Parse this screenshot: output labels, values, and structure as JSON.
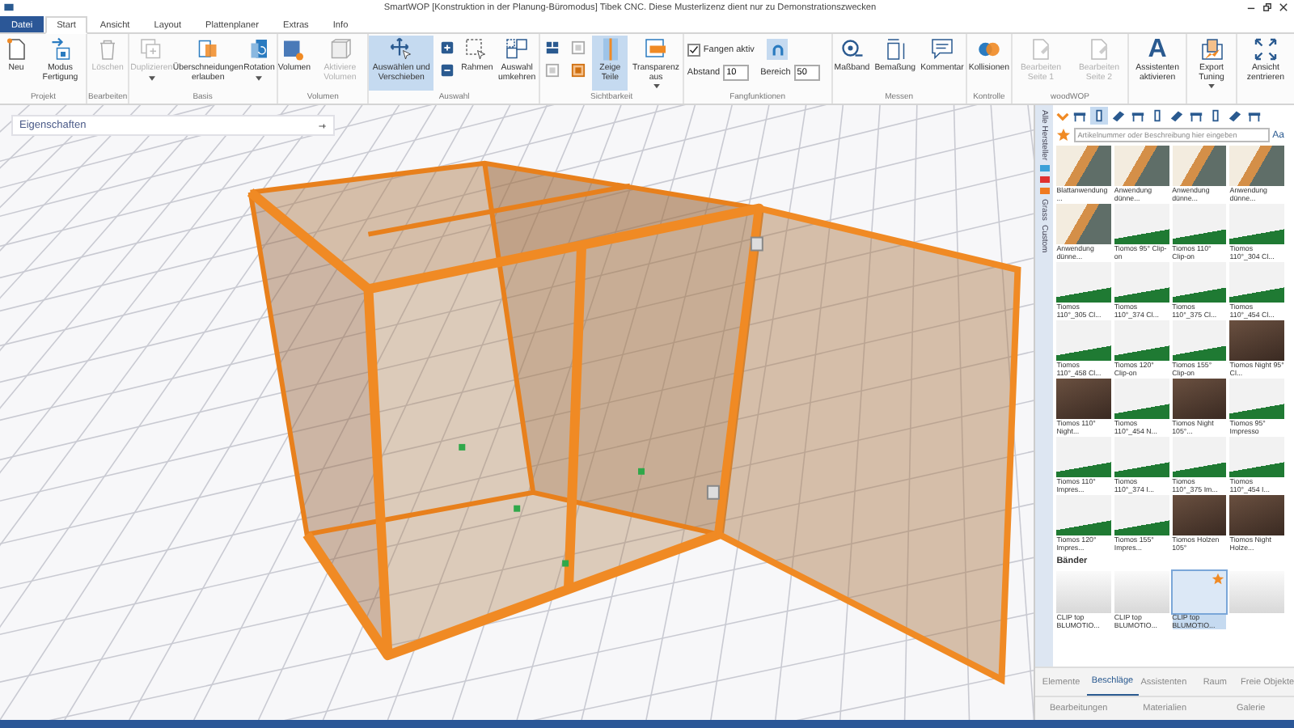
{
  "window": {
    "title": "SmartWOP [Konstruktion in der Planung-Büromodus] Tibek CNC. Diese Musterlizenz dient nur zu Demonstrationszwecken"
  },
  "menu_tabs": [
    {
      "label": "Datei",
      "kind": "file",
      "selected": false
    },
    {
      "label": "Start",
      "kind": "tab",
      "selected": true
    },
    {
      "label": "Ansicht",
      "kind": "tab",
      "selected": false
    },
    {
      "label": "Layout",
      "kind": "tab",
      "selected": false
    },
    {
      "label": "Plattenplaner",
      "kind": "tab",
      "selected": false
    },
    {
      "label": "Extras",
      "kind": "tab",
      "selected": false
    },
    {
      "label": "Info",
      "kind": "tab",
      "selected": false
    }
  ],
  "ribbon": {
    "groups": [
      {
        "label": "Projekt",
        "items": [
          {
            "kind": "large",
            "label": "Neu",
            "disabled": false,
            "selected": false
          },
          {
            "kind": "large",
            "label": "Modus Fertigung",
            "disabled": false,
            "selected": false
          }
        ]
      },
      {
        "label": "Bearbeiten",
        "items": [
          {
            "kind": "large",
            "label": "Löschen",
            "disabled": true,
            "selected": false
          }
        ]
      },
      {
        "label": "Basis",
        "items": [
          {
            "kind": "large",
            "label": "Duplizieren",
            "disabled": true,
            "selected": false,
            "dropdown": true
          },
          {
            "kind": "large",
            "label": "Überschneidungen erlauben",
            "disabled": false,
            "selected": false
          },
          {
            "kind": "large",
            "label": "Rotation",
            "disabled": false,
            "selected": false,
            "dropdown": true
          }
        ]
      },
      {
        "label": "Volumen",
        "items": [
          {
            "kind": "large",
            "label": "Volumen",
            "disabled": false,
            "selected": false
          },
          {
            "kind": "large",
            "label": "Aktiviere Volumen",
            "disabled": true,
            "selected": false
          }
        ]
      },
      {
        "label": "Auswahl",
        "items": [
          {
            "kind": "large",
            "label": "Auswählen und Verschieben",
            "disabled": false,
            "selected": true
          },
          {
            "kind": "small_stack"
          },
          {
            "kind": "large",
            "label": "Rahmen",
            "disabled": false,
            "selected": false
          },
          {
            "kind": "large",
            "label": "Auswahl umkehren",
            "disabled": false,
            "selected": false
          }
        ]
      },
      {
        "label": "Sichtbarkeit",
        "items": [
          {
            "kind": "small_stack"
          },
          {
            "kind": "small_stack"
          },
          {
            "kind": "large",
            "label": "Zeige Teile",
            "disabled": false,
            "selected": true
          },
          {
            "kind": "large",
            "label": "Transparenz aus",
            "disabled": false,
            "selected": false,
            "dropdown": true
          }
        ]
      },
      {
        "label": "Fangfunktionen",
        "items": [
          {
            "kind": "snap",
            "check_label": "Fangen aktiv",
            "checked": true,
            "magnet_selected": true,
            "fields": [
              {
                "label": "Abstand",
                "value": "10"
              },
              {
                "label": "Bereich",
                "value": "50"
              }
            ]
          }
        ]
      },
      {
        "label": "Messen",
        "items": [
          {
            "kind": "large",
            "label": "Maßband",
            "disabled": false,
            "selected": false
          },
          {
            "kind": "large",
            "label": "Bemaßung",
            "disabled": false,
            "selected": false
          },
          {
            "kind": "large",
            "label": "Kommentar",
            "disabled": false,
            "selected": false
          }
        ]
      },
      {
        "label": "Kontrolle",
        "items": [
          {
            "kind": "large",
            "label": "Kollisionen",
            "disabled": false,
            "selected": false
          }
        ]
      },
      {
        "label": "woodWOP",
        "items": [
          {
            "kind": "large",
            "label": "Bearbeiten Seite 1",
            "disabled": true,
            "selected": false
          },
          {
            "kind": "large",
            "label": "Bearbeiten Seite 2",
            "disabled": true,
            "selected": false
          }
        ]
      },
      {
        "items": [
          {
            "kind": "large",
            "label": "Assistenten aktivieren",
            "glyph": "A",
            "disabled": false,
            "selected": false
          }
        ]
      },
      {
        "items": [
          {
            "kind": "large",
            "label": "Export Tuning",
            "disabled": false,
            "selected": false,
            "dropdown": true
          }
        ]
      },
      {
        "items": [
          {
            "kind": "large",
            "label": "Ansicht zentrieren",
            "disabled": false,
            "selected": false
          }
        ]
      }
    ]
  },
  "properties_panel": {
    "title": "Eigenschaften"
  },
  "library": {
    "side_tabs": [
      {
        "label": "Alle Hersteller",
        "kind": "text"
      },
      {
        "kind": "logo",
        "color": "#3aa0d8"
      },
      {
        "kind": "logo",
        "color": "#e03030"
      },
      {
        "kind": "logo",
        "color": "#f07a20"
      },
      {
        "label": "Grass",
        "kind": "text"
      },
      {
        "label": "Custom",
        "kind": "text"
      }
    ],
    "category_icons": [
      {
        "selected": false
      },
      {
        "selected": true
      },
      {
        "selected": false
      },
      {
        "selected": false
      },
      {
        "selected": false
      },
      {
        "selected": false
      },
      {
        "selected": false
      },
      {
        "selected": false
      },
      {
        "selected": false
      },
      {
        "selected": false
      }
    ],
    "search": {
      "placeholder": "Artikelnummer oder Beschreibung hier eingeben"
    },
    "case_toggle": "Aa",
    "items": [
      {
        "caption": "Blattanwendung ...",
        "kind": "wall"
      },
      {
        "caption": "Anwendung dünne...",
        "kind": "wall"
      },
      {
        "caption": "Anwendung dünne...",
        "kind": "wall"
      },
      {
        "caption": "Anwendung dünne...",
        "kind": "wall"
      },
      {
        "caption": "Anwendung dünne...",
        "kind": "wall"
      },
      {
        "caption": "Tiomos 95° Clip-on",
        "kind": "hinge"
      },
      {
        "caption": "Tiomos 110° Clip-on",
        "kind": "hinge"
      },
      {
        "caption": "Tiomos 110°_304 Cl...",
        "kind": "hinge"
      },
      {
        "caption": "Tiomos 110°_305 Cl...",
        "kind": "hinge"
      },
      {
        "caption": "Tiomos 110°_374 Cl...",
        "kind": "hinge"
      },
      {
        "caption": "Tiomos 110°_375 Cl...",
        "kind": "hinge"
      },
      {
        "caption": "Tiomos 110°_454 Cl...",
        "kind": "hinge"
      },
      {
        "caption": "Tiomos 110°_458 Cl...",
        "kind": "hinge"
      },
      {
        "caption": "Tiomos 120° Clip-on",
        "kind": "hinge"
      },
      {
        "caption": "Tiomos 155° Clip-on",
        "kind": "hinge"
      },
      {
        "caption": "Tiomos Night 95° Cl...",
        "kind": "wood"
      },
      {
        "caption": "Tiomos 110° Night...",
        "kind": "wood"
      },
      {
        "caption": "Tiomos 110°_454 N...",
        "kind": "hinge"
      },
      {
        "caption": "Tiomos Night 105°...",
        "kind": "wood"
      },
      {
        "caption": "Tiomos 95° Impresso",
        "kind": "hinge"
      },
      {
        "caption": "Tiomos 110° Impres...",
        "kind": "hinge"
      },
      {
        "caption": "Tiomos 110°_374 I...",
        "kind": "hinge"
      },
      {
        "caption": "Tiomos 110°_375 Im...",
        "kind": "hinge"
      },
      {
        "caption": "Tiomos 110°_454 I...",
        "kind": "hinge"
      },
      {
        "caption": "Tiomos 120° Impres...",
        "kind": "hinge"
      },
      {
        "caption": "Tiomos 155° Impres...",
        "kind": "hinge"
      },
      {
        "caption": "Tiomos Holzen 105°",
        "kind": "wood"
      },
      {
        "caption": "Tiomos Night Holze...",
        "kind": "wood"
      }
    ],
    "section_title": "Bänder",
    "section_items": [
      {
        "caption": "CLIP top BLUMOTIO...",
        "selected": false,
        "favorite": false
      },
      {
        "caption": "CLIP top BLUMOTIO...",
        "selected": false,
        "favorite": false
      },
      {
        "caption": "CLIP top BLUMOTIO...",
        "selected": true,
        "favorite": true
      },
      {
        "selected": false,
        "favorite": false
      }
    ],
    "bottom_tabs": [
      {
        "label": "Elemente",
        "selected": false
      },
      {
        "label": "Beschläge",
        "selected": true
      },
      {
        "label": "Assistenten",
        "selected": false
      },
      {
        "label": "Raum",
        "selected": false
      },
      {
        "label": "Freie Objekte",
        "selected": false
      }
    ],
    "bottom_tabs_2": [
      {
        "label": "Bearbeitungen",
        "selected": false
      },
      {
        "label": "Materialien",
        "selected": false
      },
      {
        "label": "Galerie",
        "selected": false
      }
    ]
  }
}
